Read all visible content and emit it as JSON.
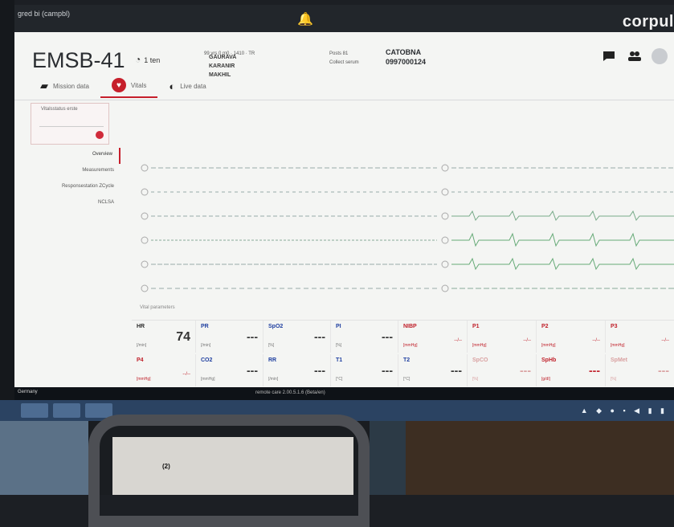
{
  "topbar": {
    "left_title": "gred bi (campbl)",
    "bell_icon": "bell-icon",
    "brand": "corpul"
  },
  "header": {
    "device_id": "EMSB-41",
    "run_time": "1 ten",
    "patient_name": "GAURAVA KARANIR MAKHIL",
    "patient_detail": "99 yrs 0 m0 · 1410 · TR",
    "mission_label_1": "Posts 81",
    "mission_label_2": "Collect serum",
    "mission_value_1": "CATOBNA",
    "mission_value_2": "0997000124",
    "icons": [
      "chat-icon",
      "people-icon",
      "settings-icon"
    ]
  },
  "tabs": [
    {
      "label": "Mission data",
      "icon": "folder-icon",
      "active": false
    },
    {
      "label": "Vitals",
      "icon": "heart-rate-icon",
      "active": true
    },
    {
      "label": "Live data",
      "icon": "live-icon",
      "active": false
    }
  ],
  "sidebar": {
    "card_title": "Vitalsstatus erste",
    "items": [
      {
        "label": "Overview",
        "active": true
      },
      {
        "label": "Measurements",
        "active": false
      },
      {
        "label": "Responsestation ZCycle",
        "active": false
      },
      {
        "label": "NCLSA",
        "active": false
      }
    ]
  },
  "waveform": {
    "recording_info": "Vital parameters"
  },
  "params_row1": [
    {
      "name": "HR",
      "unit": "[/min]",
      "value": "74",
      "color": "#2a2a2a"
    },
    {
      "name": "PR",
      "unit": "[/min]",
      "value": "---",
      "color": "#1f3fa0"
    },
    {
      "name": "SpO2",
      "unit": "[%]",
      "value": "---",
      "color": "#1f3fa0"
    },
    {
      "name": "PI",
      "unit": "[%]",
      "value": "---",
      "color": "#1f3fa0"
    },
    {
      "name": "NIBP",
      "unit": "[mmHg]",
      "value": "--/--",
      "color": "#c0202a"
    },
    {
      "name": "P1",
      "unit": "[mmHg]",
      "value": "--/--",
      "color": "#c0202a"
    },
    {
      "name": "P2",
      "unit": "[mmHg]",
      "value": "--/--",
      "color": "#c0202a"
    },
    {
      "name": "P3",
      "unit": "[mmHg]",
      "value": "--/--",
      "color": "#c0202a"
    }
  ],
  "params_row2": [
    {
      "name": "P4",
      "unit": "[mmHg]",
      "value": "--/--",
      "color": "#c0202a"
    },
    {
      "name": "CO2",
      "unit": "[mmHg]",
      "value": "---",
      "color": "#1f3fa0"
    },
    {
      "name": "RR",
      "unit": "[/min]",
      "value": "---",
      "color": "#1f3fa0"
    },
    {
      "name": "T1",
      "unit": "[°C]",
      "value": "---",
      "color": "#1f3fa0"
    },
    {
      "name": "T2",
      "unit": "[°C]",
      "value": "---",
      "color": "#1f3fa0"
    },
    {
      "name": "SpCO",
      "unit": "[%]",
      "value": "---",
      "color": "#d9a0a0"
    },
    {
      "name": "SpHb",
      "unit": "[g/dl]",
      "value": "---",
      "color": "#c0202a"
    },
    {
      "name": "SpMet",
      "unit": "[%]",
      "value": "---",
      "color": "#d9a0a0"
    }
  ],
  "taskbar": {
    "left": "Germany",
    "center": "remote care 2.00.5.1.6 (Beta/en)"
  },
  "photo": {
    "glass_label": "(2)"
  }
}
